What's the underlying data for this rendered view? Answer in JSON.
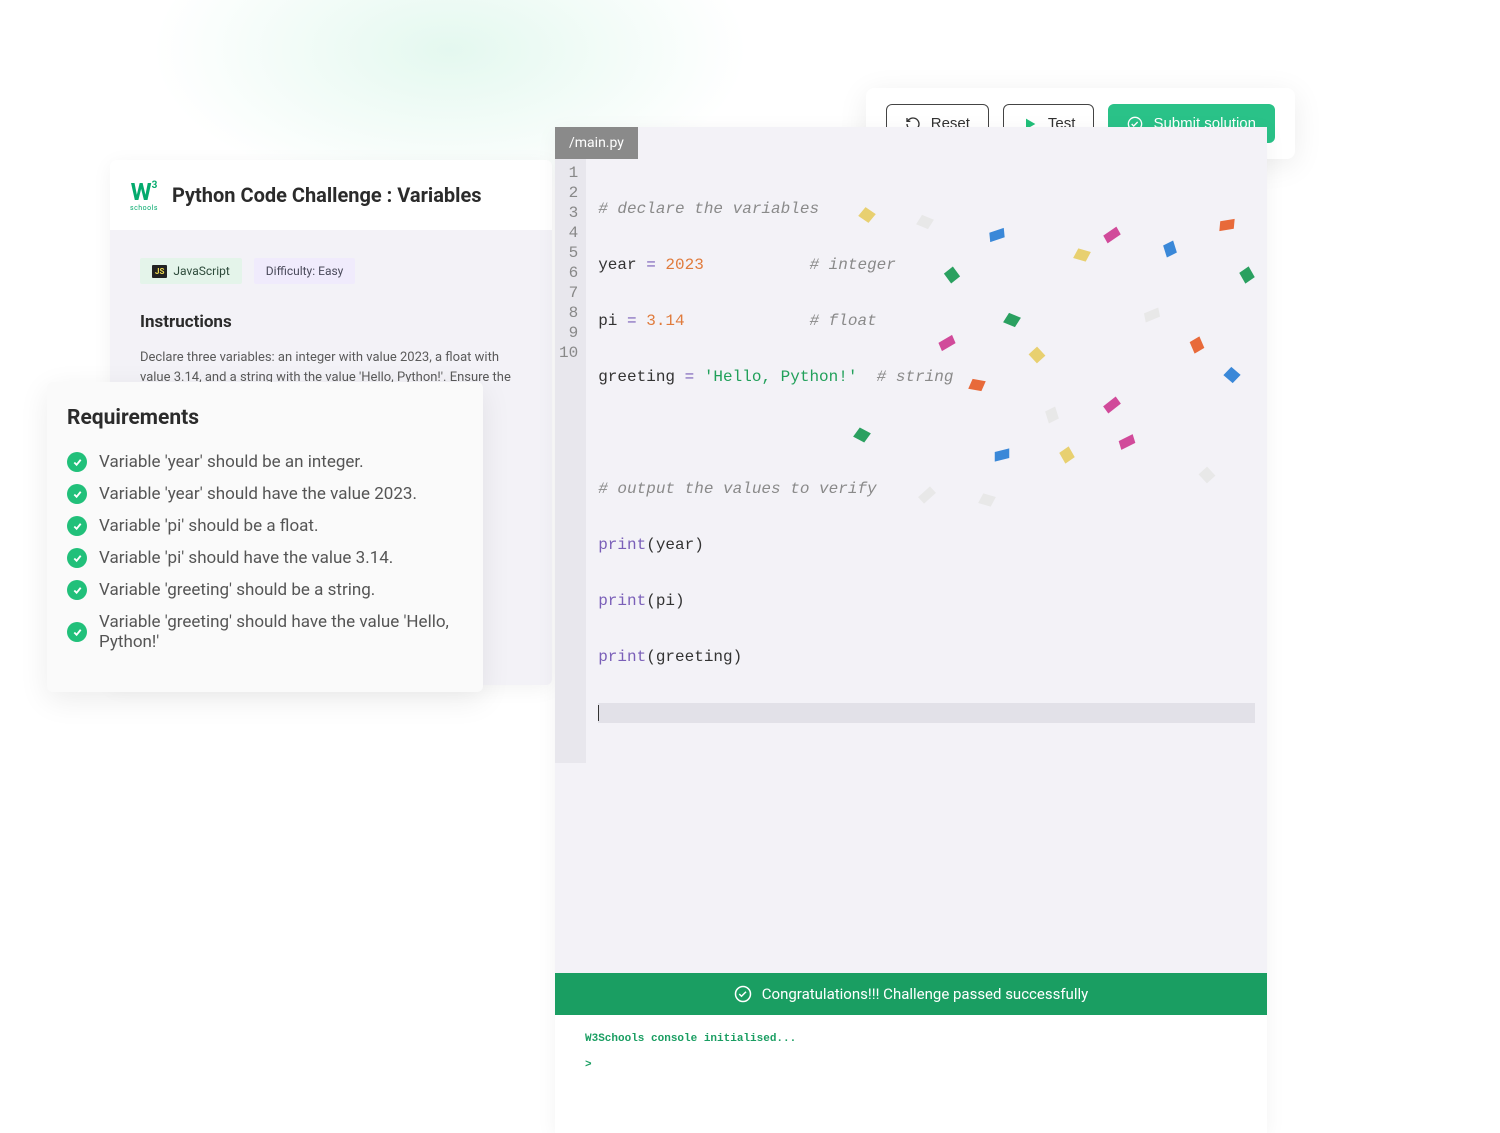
{
  "logo": {
    "mark": "W",
    "sup": "3",
    "text": "schools"
  },
  "challenge": {
    "title": "Python Code Challenge : Variables",
    "tags": {
      "language": "JavaScript",
      "lang_badge": "JS",
      "difficulty": "Difficulty: Easy"
    },
    "instructions_title": "Instructions",
    "instructions_text": "Declare three variables: an integer with value 2023, a float with value 3.14, and a string with the value 'Hello, Python!'. Ensure the variables are anmed year, pi and greeting rewspectivelt"
  },
  "requirements": {
    "title": "Requirements",
    "items": [
      "Variable 'year' should be an integer.",
      "Variable 'year' should have the value 2023.",
      "Variable 'pi' should be a float.",
      "Variable 'pi' should have the value 3.14.",
      "Variable 'greeting' should be a string.",
      "Variable 'greeting' should have the value 'Hello, Python!'"
    ]
  },
  "actions": {
    "reset": "Reset",
    "test": "Test",
    "submit": "Submit solution"
  },
  "editor": {
    "tab": "/main.py",
    "lines": [
      "1",
      "2",
      "3",
      "4",
      "5",
      "6",
      "7",
      "8",
      "9",
      "10"
    ],
    "code": {
      "l1_comment": "# declare the variables",
      "l2_var": "year",
      "l2_op": " = ",
      "l2_val": "2023",
      "l2_pad": "           ",
      "l2_comment": "# integer",
      "l3_var": "pi",
      "l3_op": " = ",
      "l3_val": "3.14",
      "l3_pad": "             ",
      "l3_comment": "# float",
      "l4_var": "greeting",
      "l4_op": " = ",
      "l4_val": "'Hello, Python!'",
      "l4_pad": "  ",
      "l4_comment": "# string",
      "l6_comment": "# output the values to verify",
      "l7_fn": "print",
      "l7_arg": "(year)",
      "l8_fn": "print",
      "l8_arg": "(pi)",
      "l9_fn": "print",
      "l9_arg": "(greeting)"
    }
  },
  "success_banner": "Congratulations!!! Challenge passed successfully",
  "console": {
    "line1": "W3Schools console initialised...",
    "prompt": ">"
  }
}
